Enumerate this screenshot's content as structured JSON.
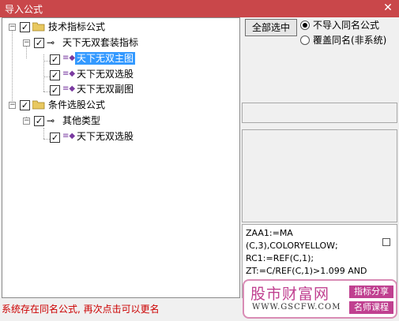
{
  "window": {
    "title": "导入公式",
    "close_glyph": "✕"
  },
  "tree": {
    "root1": {
      "label": "技术指标公式"
    },
    "group1": {
      "label": "天下无双套装指标"
    },
    "items1": [
      "天下无双主图",
      "天下无双选股",
      "天下无双副图"
    ],
    "root2": {
      "label": "条件选股公式"
    },
    "group2": {
      "label": "其他类型"
    },
    "items2": [
      "天下无双选股"
    ],
    "expander_glyph": "−",
    "check_glyph": "✓",
    "key_glyph": "⊸",
    "formula_glyph": "≡◆",
    "selected_item": "天下无双主图"
  },
  "options": {
    "select_all_label": "全部选中",
    "radio1_label": "不导入同名公式",
    "radio2_label": "覆盖同名(非系统)",
    "selected_radio": 1
  },
  "code": {
    "lines": [
      "ZAA1:=MA",
      "(C,3),COLORYELLOW;",
      "RC1:=REF(C,1);",
      "ZT:=C/REF(C,1)>1.099 AND"
    ]
  },
  "status": {
    "text": "系统存在同名公式, 再次点击可以更名"
  },
  "watermark": {
    "site_name": "股市财富网",
    "url": "WWW.GSCFW.COM",
    "tag1": "指标分享",
    "tag2": "名师课程"
  },
  "colors": {
    "titlebar": "#c9474a",
    "selection": "#3399ff",
    "status_text": "#cc0000",
    "watermark_accent": "#c04090"
  }
}
